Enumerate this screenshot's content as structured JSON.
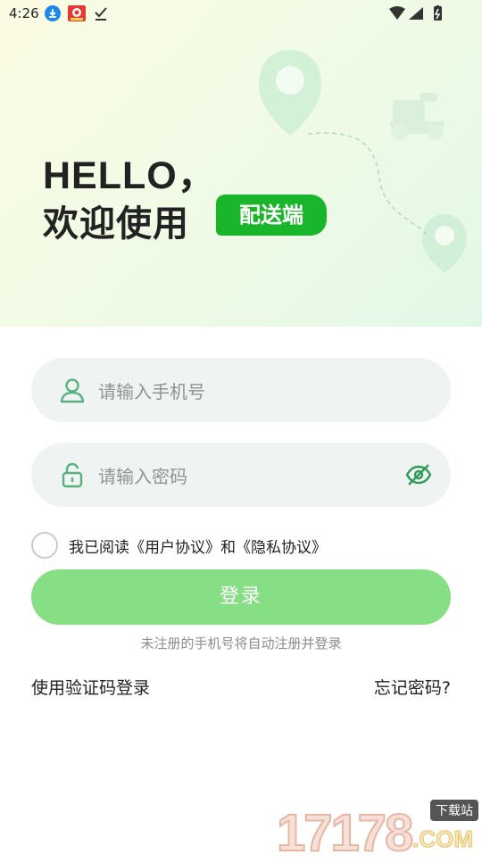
{
  "status_bar": {
    "time": "4:26"
  },
  "hero": {
    "greeting": "HELLO，",
    "welcome": "欢迎使用",
    "badge": "配送端"
  },
  "form": {
    "phone_placeholder": "请输入手机号",
    "password_placeholder": "请输入密码",
    "agreement_text": "我已阅读《用户协议》和《隐私协议》",
    "login_label": "登录",
    "hint": "未注册的手机号将自动注册并登录",
    "code_login_label": "使用验证码登录",
    "forgot_label": "忘记密码?"
  },
  "watermark": {
    "digits": "17178",
    "tag": "下载站",
    "domain": ".COM"
  },
  "colors": {
    "brand_green": "#19b52b",
    "button_green": "#86df84",
    "icon_green": "#58b27f",
    "field_bg": "#eff3f1"
  }
}
